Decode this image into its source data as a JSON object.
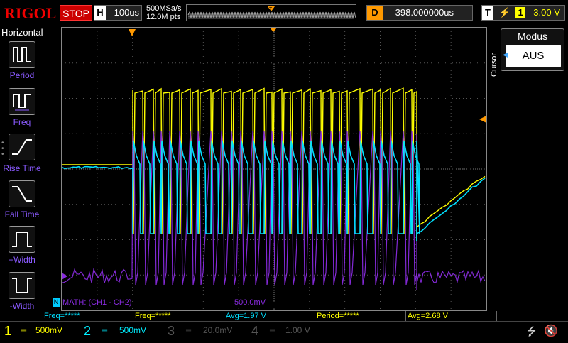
{
  "brand": {
    "logo": "RIGOL",
    "run_state": "STOP"
  },
  "horizontal": {
    "key": "H",
    "timebase": "100us",
    "sample_rate": "500MSa/s",
    "mem_depth": "12.0M pts"
  },
  "delay": {
    "key": "D",
    "value": "398.000000us"
  },
  "trigger": {
    "key": "T",
    "source": "1",
    "level": "3.00 V"
  },
  "left_menu": {
    "title": "Horizontal",
    "items": [
      {
        "label": "Period"
      },
      {
        "label": "Freq"
      },
      {
        "label": "Rise Time"
      },
      {
        "label": "Fall Time"
      },
      {
        "label": "+Width"
      },
      {
        "label": "-Width"
      }
    ]
  },
  "right_menu": {
    "title": "Modus",
    "value": "AUS",
    "side_label": "Cursor"
  },
  "math": {
    "label": "MATH: (CH1 - CH2)",
    "scale": "500.0mV",
    "marker": "M"
  },
  "measurements": [
    {
      "text": "Freq=*****",
      "color": "#00e0ff"
    },
    {
      "text": "Freq=*****",
      "color": "#ffff00"
    },
    {
      "text": "Avg=1.97 V",
      "color": "#00e0ff"
    },
    {
      "text": "Period=*****",
      "color": "#ffff00"
    },
    {
      "text": "Avg=2.68 V",
      "color": "#ffff00"
    }
  ],
  "channels": [
    {
      "num": "1",
      "scale": "500mV",
      "color": "#ffff00"
    },
    {
      "num": "2",
      "scale": "500mV",
      "color": "#00e0ff"
    },
    {
      "num": "3",
      "scale": "20.0mV",
      "color": "#555555"
    },
    {
      "num": "4",
      "scale": "1.00 V",
      "color": "#555555"
    }
  ],
  "colors": {
    "ch1": "#ffff00",
    "ch2": "#00e0ff",
    "math": "#8a2be2",
    "trigger": "#ff9900"
  }
}
